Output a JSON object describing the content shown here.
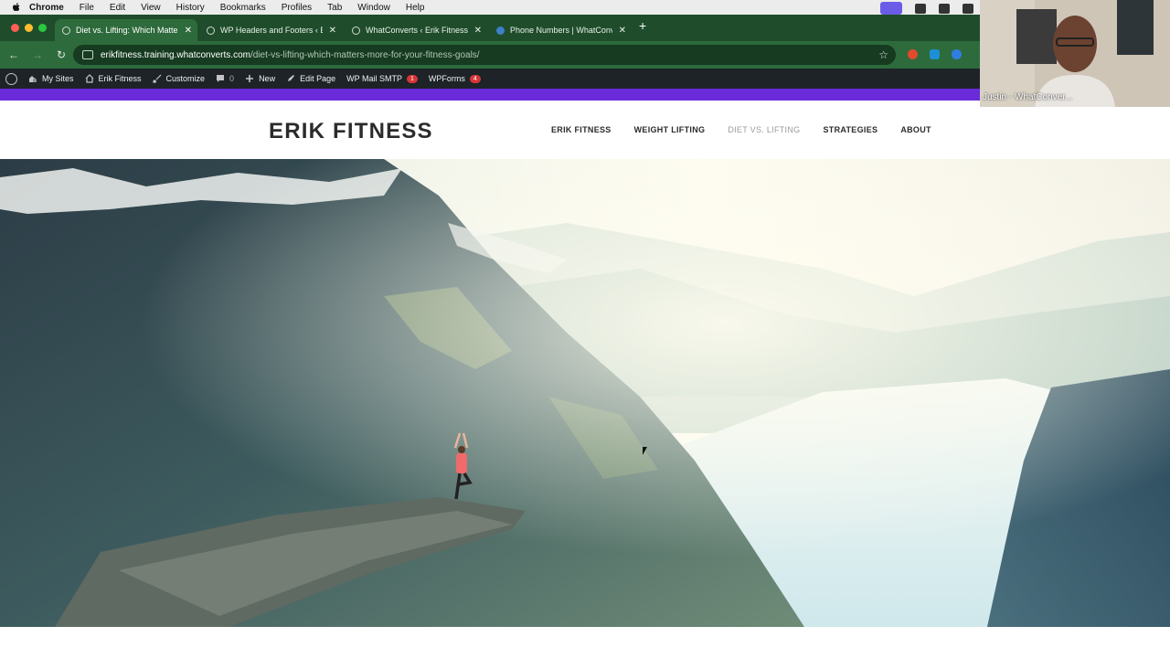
{
  "mac_menu": {
    "app": "Chrome",
    "items": [
      "File",
      "Edit",
      "View",
      "History",
      "Bookmarks",
      "Profiles",
      "Tab",
      "Window",
      "Help"
    ]
  },
  "tabs": [
    {
      "title": "Diet vs. Lifting: Which Matters",
      "active": true,
      "favicon": "globe-icon"
    },
    {
      "title": "WP Headers and Footers ‹ Er",
      "active": false,
      "favicon": "globe-icon"
    },
    {
      "title": "WhatConverts ‹ Erik Fitness",
      "active": false,
      "favicon": "globe-icon"
    },
    {
      "title": "Phone Numbers | WhatConve",
      "active": false,
      "favicon": "whatconverts-icon"
    }
  ],
  "address_bar": {
    "host": "erikfitness.training.whatconverts.com",
    "path": "/diet-vs-lifting-which-matters-more-for-your-fitness-goals/"
  },
  "wp_admin_bar": {
    "my_sites": "My Sites",
    "site_name": "Erik Fitness",
    "customize": "Customize",
    "comments_count": "0",
    "new": "New",
    "edit_page": "Edit Page",
    "wp_mail_smtp": "WP Mail SMTP",
    "wp_mail_smtp_badge": "1",
    "wpforms": "WPForms",
    "wpforms_badge": "4"
  },
  "site": {
    "logo": "ERIK FITNESS",
    "nav": [
      {
        "label": "ERIK FITNESS",
        "current": false
      },
      {
        "label": "WEIGHT LIFTING",
        "current": false
      },
      {
        "label": "DIET VS. LIFTING",
        "current": true
      },
      {
        "label": "STRATEGIES",
        "current": false
      },
      {
        "label": "ABOUT",
        "current": false
      }
    ]
  },
  "webcam": {
    "label": "Justin - WhatConver..."
  },
  "colors": {
    "tabstrip": "#1f4d2b",
    "toolbar": "#2e6b3c",
    "wp_admin_bar": "#1d2327",
    "accent_purple": "#6a2bd8"
  }
}
